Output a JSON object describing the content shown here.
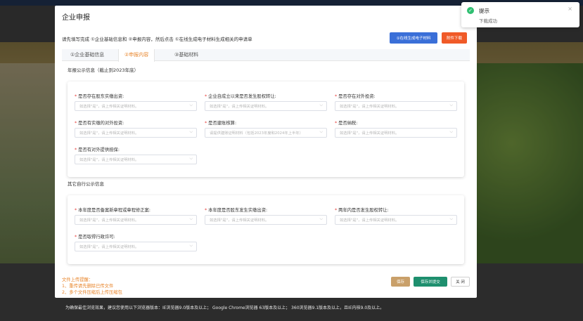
{
  "dialog": {
    "title": "企业申报",
    "instruction": "请先填写完成 ①企业基础信息和 ②申报内容，然后点击 ①在线生成电子材料生成相关的申请单",
    "btn_generate": "①在线生成电子材料",
    "btn_download": "附件下载"
  },
  "tabs": [
    "①企业基础信息",
    "②申报内容",
    "③基础材料"
  ],
  "section1": {
    "label": "年报公示信息（截止到2023年底）",
    "fields": [
      {
        "label": "是否存在股东实缴出资:",
        "placeholder": "如选择\"是\"，请上传相关证明材料。"
      },
      {
        "label": "企业自成立以来是否发生股权转让:",
        "placeholder": "如选择\"是\"，请上传相关证明材料。"
      },
      {
        "label": "是否存在对外投资:",
        "placeholder": "如选择\"是\"，请上传相关证明材料。"
      },
      {
        "label": "是否有实缴的对外投资:",
        "placeholder": "如选择\"是\"，请上传相关证明材料。"
      },
      {
        "label": "是否建账核算:",
        "placeholder": "请提供建账证明材料（包括2023年度和2024年上半年）"
      },
      {
        "label": "是否纳税:",
        "placeholder": "如选择\"是\"，请上传相关证明材料。"
      },
      {
        "label": "是否有对外提供担保:",
        "placeholder": "如选择\"是\"，请上传相关证明材料。"
      }
    ]
  },
  "section2": {
    "label": "其它自行公示信息",
    "fields": [
      {
        "label": "本年度是否备案新章程或章程修正案:",
        "placeholder": "如选择\"是\"，请上传相关证明材料。"
      },
      {
        "label": "本年度是否股东发生实缴出资:",
        "placeholder": "如选择\"是\"，请上传相关证明材料。"
      },
      {
        "label": "两年内是否发生股权转让:",
        "placeholder": "如选择\"是\"，请上传相关证明材料。"
      },
      {
        "label": "是否取得行政许可:",
        "placeholder": "如选择\"是\"，请上传相关证明材料。"
      }
    ]
  },
  "upload_tip": {
    "title": "文件上传提醒：",
    "line1": "1、重传请先删除已传文件",
    "line2": "2、多个文件压缩后上传压缩包"
  },
  "buttons": {
    "save": "保存",
    "save_submit": "保存并提交",
    "close": "关 闭"
  },
  "toast": {
    "title": "提示",
    "message": "下载成功",
    "close": "×",
    "icon": "check-icon"
  },
  "footer": {
    "note": "为确保最佳浏览效果，建议您使用以下浏览器版本：IE浏览器9.0版本及以上； Google Chrome浏览器 63版本及以上； 360浏览器9.1版本及以上，且IE内核9.0及以上。"
  }
}
